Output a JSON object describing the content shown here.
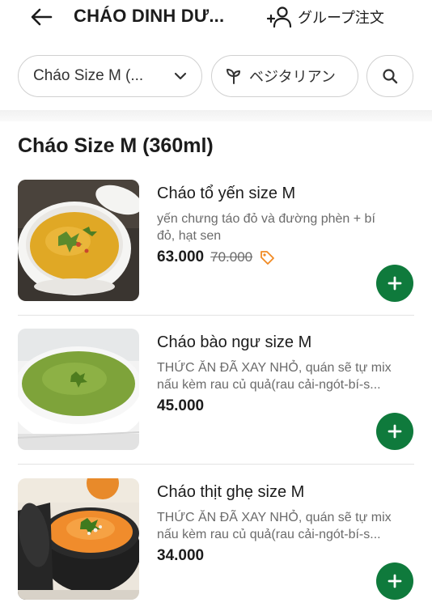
{
  "header": {
    "title": "CHÁO DINH DƯ...",
    "group_order_label": "グループ注文"
  },
  "filters": {
    "size_chip": "Cháo Size M (...",
    "vegetarian_chip": "ベジタリアン"
  },
  "section": {
    "title": "Cháo Size M (360ml)"
  },
  "items": [
    {
      "name": "Cháo tổ yến size M",
      "desc_line1": "yến chưng táo đỏ và đường phèn + bí",
      "desc_line2": "đỏ, hạt sen",
      "price": "63.000",
      "old_price": "70.000"
    },
    {
      "name": "Cháo bào ngư size M",
      "desc_line1": "THỨC ĂN ĐÃ XAY NHỎ, quán sẽ tự mix",
      "desc_line2": "nấu kèm rau củ quả(rau cải-ngót-bí-s...",
      "price": "45.000"
    },
    {
      "name": "Cháo thịt ghẹ size M",
      "desc_line1": "THỨC ĂN ĐÃ XAY NHỎ, quán sẽ tự mix",
      "desc_line2": "nấu kèm rau củ quả(rau cải-ngót-bí-s...",
      "price": "34.000"
    }
  ],
  "colors": {
    "accent": "#0f7a3c",
    "promo_tag": "#f08a24"
  }
}
